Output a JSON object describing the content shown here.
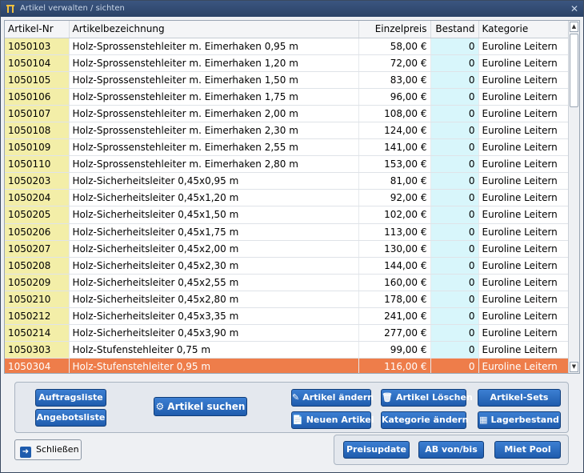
{
  "window": {
    "title": "Artikel verwalten / sichten",
    "close": "✕"
  },
  "columns": [
    "Artikel-Nr",
    "Artikelbezeichnung",
    "Einzelpreis",
    "Bestand",
    "Kategorie"
  ],
  "rows": [
    [
      "1050103",
      "Holz-Sprossenstehleiter m. Eimerhaken 0,95 m",
      "58,00 €",
      "0",
      "Euroline Leitern"
    ],
    [
      "1050104",
      "Holz-Sprossenstehleiter m. Eimerhaken 1,20 m",
      "72,00 €",
      "0",
      "Euroline Leitern"
    ],
    [
      "1050105",
      "Holz-Sprossenstehleiter m. Eimerhaken 1,50 m",
      "83,00 €",
      "0",
      "Euroline Leitern"
    ],
    [
      "1050106",
      "Holz-Sprossenstehleiter m. Eimerhaken 1,75 m",
      "96,00 €",
      "0",
      "Euroline Leitern"
    ],
    [
      "1050107",
      "Holz-Sprossenstehleiter m. Eimerhaken 2,00 m",
      "108,00 €",
      "0",
      "Euroline Leitern"
    ],
    [
      "1050108",
      "Holz-Sprossenstehleiter m. Eimerhaken 2,30 m",
      "124,00 €",
      "0",
      "Euroline Leitern"
    ],
    [
      "1050109",
      "Holz-Sprossenstehleiter m. Eimerhaken 2,55 m",
      "141,00 €",
      "0",
      "Euroline Leitern"
    ],
    [
      "1050110",
      "Holz-Sprossenstehleiter m. Eimerhaken 2,80 m",
      "153,00 €",
      "0",
      "Euroline Leitern"
    ],
    [
      "1050203",
      "Holz-Sicherheitsleiter 0,45x0,95 m",
      "81,00 €",
      "0",
      "Euroline Leitern"
    ],
    [
      "1050204",
      "Holz-Sicherheitsleiter 0,45x1,20 m",
      "92,00 €",
      "0",
      "Euroline Leitern"
    ],
    [
      "1050205",
      "Holz-Sicherheitsleiter 0,45x1,50 m",
      "102,00 €",
      "0",
      "Euroline Leitern"
    ],
    [
      "1050206",
      "Holz-Sicherheitsleiter 0,45x1,75 m",
      "113,00 €",
      "0",
      "Euroline Leitern"
    ],
    [
      "1050207",
      "Holz-Sicherheitsleiter 0,45x2,00 m",
      "130,00 €",
      "0",
      "Euroline Leitern"
    ],
    [
      "1050208",
      "Holz-Sicherheitsleiter 0,45x2,30 m",
      "144,00 €",
      "0",
      "Euroline Leitern"
    ],
    [
      "1050209",
      "Holz-Sicherheitsleiter 0,45x2,55 m",
      "160,00 €",
      "0",
      "Euroline Leitern"
    ],
    [
      "1050210",
      "Holz-Sicherheitsleiter 0,45x2,80 m",
      "178,00 €",
      "0",
      "Euroline Leitern"
    ],
    [
      "1050212",
      "Holz-Sicherheitsleiter 0,45x3,35 m",
      "241,00 €",
      "0",
      "Euroline Leitern"
    ],
    [
      "1050214",
      "Holz-Sicherheitsleiter 0,45x3,90 m",
      "277,00 €",
      "0",
      "Euroline Leitern"
    ],
    [
      "1050303",
      "Holz-Stufenstehleiter 0,75 m",
      "99,00 €",
      "0",
      "Euroline Leitern"
    ],
    [
      "1050304",
      "Holz-Stufenstehleiter 0,95 m",
      "116,00 €",
      "0",
      "Euroline Leitern"
    ]
  ],
  "selected_row": 19,
  "buttons": {
    "auftragsliste": "Auftragsliste",
    "angebotsliste": "Angebotsliste",
    "artikel_suchen": "Artikel suchen",
    "artikel_aendern": "Artikel ändern",
    "artikel_loeschen": "Artikel Löschen",
    "artikel_sets": "Artikel-Sets",
    "neuen_artikel": "Neuen Artikel",
    "kategorie_aendern": "Kategorie ändern",
    "lagerbestand": "Lagerbestand",
    "schliessen": "Schließen",
    "preisupdate": "Preisupdate",
    "ab_von_bis": "AB von/bis",
    "miet_pool": "Miet Pool"
  },
  "colors": {
    "accent": "#1f5cad",
    "selected": "#ee7d4a",
    "nr_column": "#f3eea8",
    "stock_column": "#d8f6fb"
  }
}
